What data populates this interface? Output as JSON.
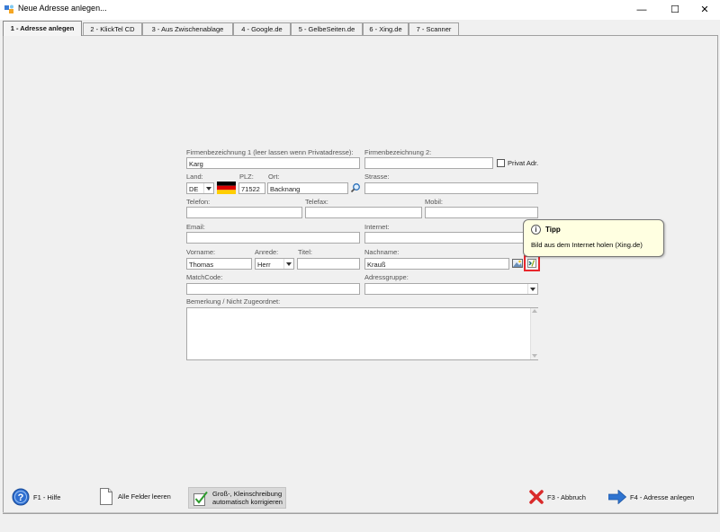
{
  "window": {
    "title": "Neue Adresse anlegen...",
    "minimize_label": "—",
    "maximize_label": "☐",
    "close_label": "✕"
  },
  "tabs": [
    {
      "label": "1 - Adresse anlegen"
    },
    {
      "label": "2 - KlickTel CD"
    },
    {
      "label": "3 - Aus Zwischenablage"
    },
    {
      "label": "4 - Google.de"
    },
    {
      "label": "5 - GelbeSeiten.de"
    },
    {
      "label": "6 - Xing.de"
    },
    {
      "label": "7 - Scanner"
    }
  ],
  "form": {
    "firma1": {
      "label": "Firmenbezeichnung 1 (leer lassen wenn Privatadresse):",
      "value": "Karg"
    },
    "firma2": {
      "label": "Firmenbezeichnung 2:",
      "value": ""
    },
    "privat": {
      "label": "Privat Adr.",
      "checked": false
    },
    "land": {
      "label": "Land:",
      "value": "DE"
    },
    "plz": {
      "label": "PLZ:",
      "value": "71522"
    },
    "ort": {
      "label": "Ort:",
      "value": "Backnang"
    },
    "strasse": {
      "label": "Strasse:",
      "value": ""
    },
    "telefon": {
      "label": "Telefon:",
      "value": ""
    },
    "telefax": {
      "label": "Telefax:",
      "value": ""
    },
    "mobil": {
      "label": "Mobil:",
      "value": ""
    },
    "email": {
      "label": "Email:",
      "value": ""
    },
    "internet": {
      "label": "Internet:",
      "value": ""
    },
    "vorname": {
      "label": "Vorname:",
      "value": "Thomas"
    },
    "anrede": {
      "label": "Anrede:",
      "value": "Herr"
    },
    "titel": {
      "label": "Titel:",
      "value": ""
    },
    "nachname": {
      "label": "Nachname:",
      "value": "Krauß"
    },
    "matchcode": {
      "label": "MatchCode:",
      "value": ""
    },
    "adressgruppe": {
      "label": "Adressgruppe:",
      "value": ""
    },
    "bemerkung": {
      "label": "Bemerkung / Nicht Zugeordnet:",
      "value": ""
    }
  },
  "tooltip": {
    "title": "Tipp",
    "text": "Bild aus dem Internet holen (Xing.de)"
  },
  "bottom": {
    "help": "F1 - Hilfe",
    "clear": "Alle Felder leeren",
    "case_line1": "Groß-, Kleinschreibung",
    "case_line2": "automatisch korrigieren",
    "cancel": "F3 - Abbruch",
    "create": "F4 - Adresse anlegen"
  },
  "colors": {
    "accent": "#1c6fd0",
    "highlight": "#e8272c",
    "tooltip_bg": "#ffffe1"
  },
  "icons": [
    "app-icon",
    "flag-germany-icon",
    "search-icon",
    "image-icon",
    "xing-icon",
    "help-icon",
    "blank-page-icon",
    "checkmark-icon",
    "cancel-x-icon",
    "arrow-right-icon",
    "info-icon"
  ]
}
